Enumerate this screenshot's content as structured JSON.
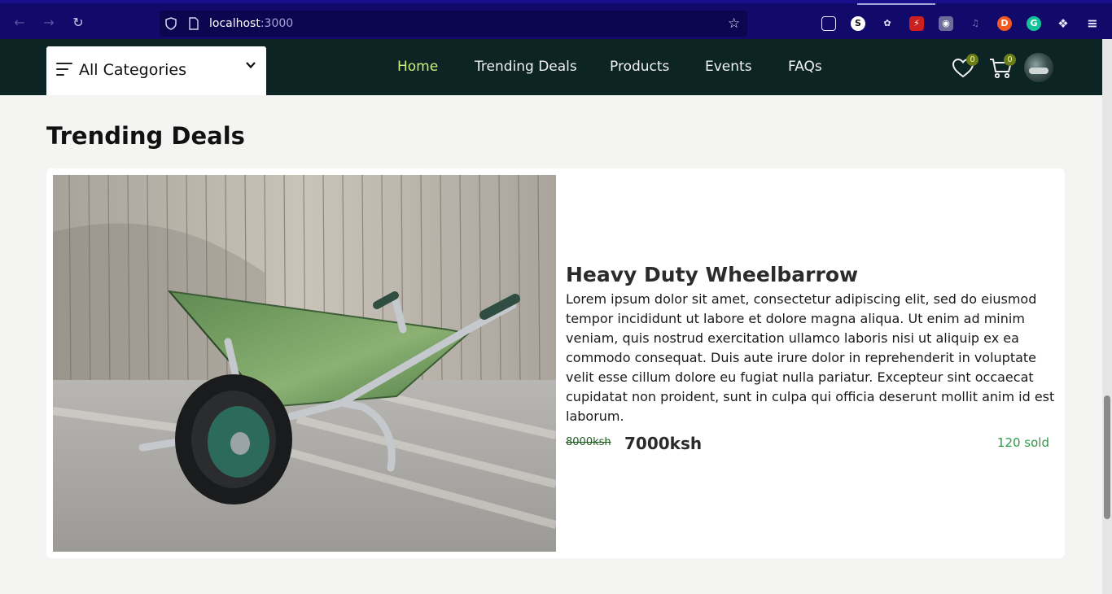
{
  "browser": {
    "url_host": "localhost",
    "url_port": ":3000"
  },
  "header": {
    "category_label": "All Categories",
    "nav": [
      "Home",
      "Trending Deals",
      "Products",
      "Events",
      "FAQs"
    ],
    "wishlist_count": "0",
    "cart_count": "0",
    "accent_color": "#c9f27a",
    "bg_color": "#0c2424"
  },
  "main": {
    "section_title": "Trending Deals",
    "product": {
      "name": "Heavy Duty Wheelbarrow",
      "description": "Lorem ipsum dolor sit amet, consectetur adipiscing elit, sed do eiusmod tempor incididunt ut labore et dolore magna aliqua. Ut enim ad minim veniam, quis nostrud exercitation ullamco laboris nisi ut aliquip ex ea commodo consequat. Duis aute irure dolor in reprehenderit in voluptate velit esse cillum dolore eu fugiat nulla pariatur. Excepteur sint occaecat cupidatat non proident, sunt in culpa qui officia deserunt mollit anim id est laborum.",
      "old_price": "8000ksh",
      "price": "7000ksh",
      "sold": "120 sold"
    }
  }
}
